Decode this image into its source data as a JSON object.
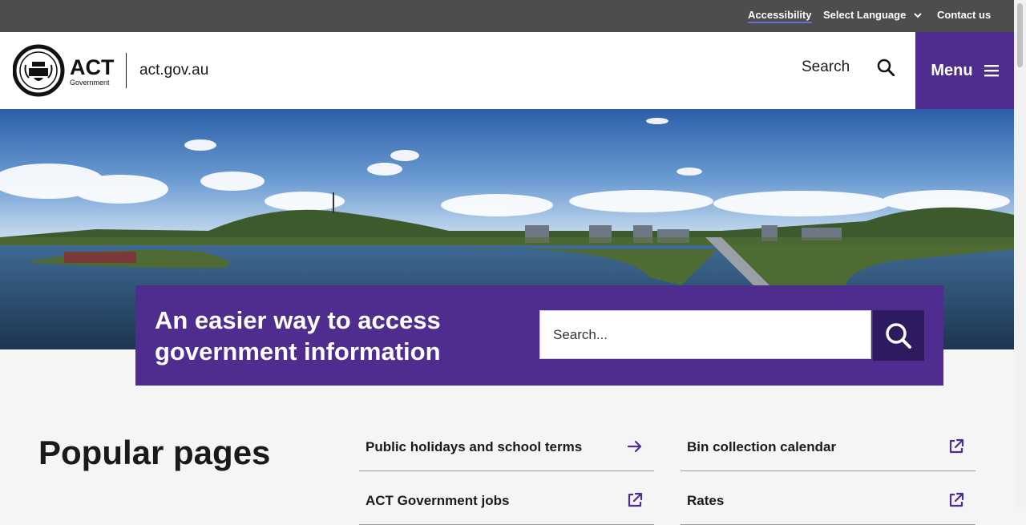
{
  "utility_bar": {
    "accessibility": "Accessibility",
    "language": "Select Language",
    "contact": "Contact us"
  },
  "header": {
    "logo_text": "ACT",
    "logo_subtext": "Government",
    "site_name": "act.gov.au",
    "search_label": "Search",
    "menu_label": "Menu"
  },
  "hero": {
    "title": "An easier way to access government information",
    "search_placeholder": "Search..."
  },
  "popular": {
    "title": "Popular pages",
    "links": [
      {
        "label": "Public holidays and school terms",
        "icon": "arrow-right-icon"
      },
      {
        "label": "Bin collection calendar",
        "icon": "external-link-icon"
      },
      {
        "label": "ACT Government jobs",
        "icon": "external-link-icon"
      },
      {
        "label": "Rates",
        "icon": "external-link-icon"
      }
    ]
  },
  "colors": {
    "brand_purple": "#4e2d8f",
    "utility_bar": "#4d4d4d",
    "search_button": "#2e1a5e"
  }
}
